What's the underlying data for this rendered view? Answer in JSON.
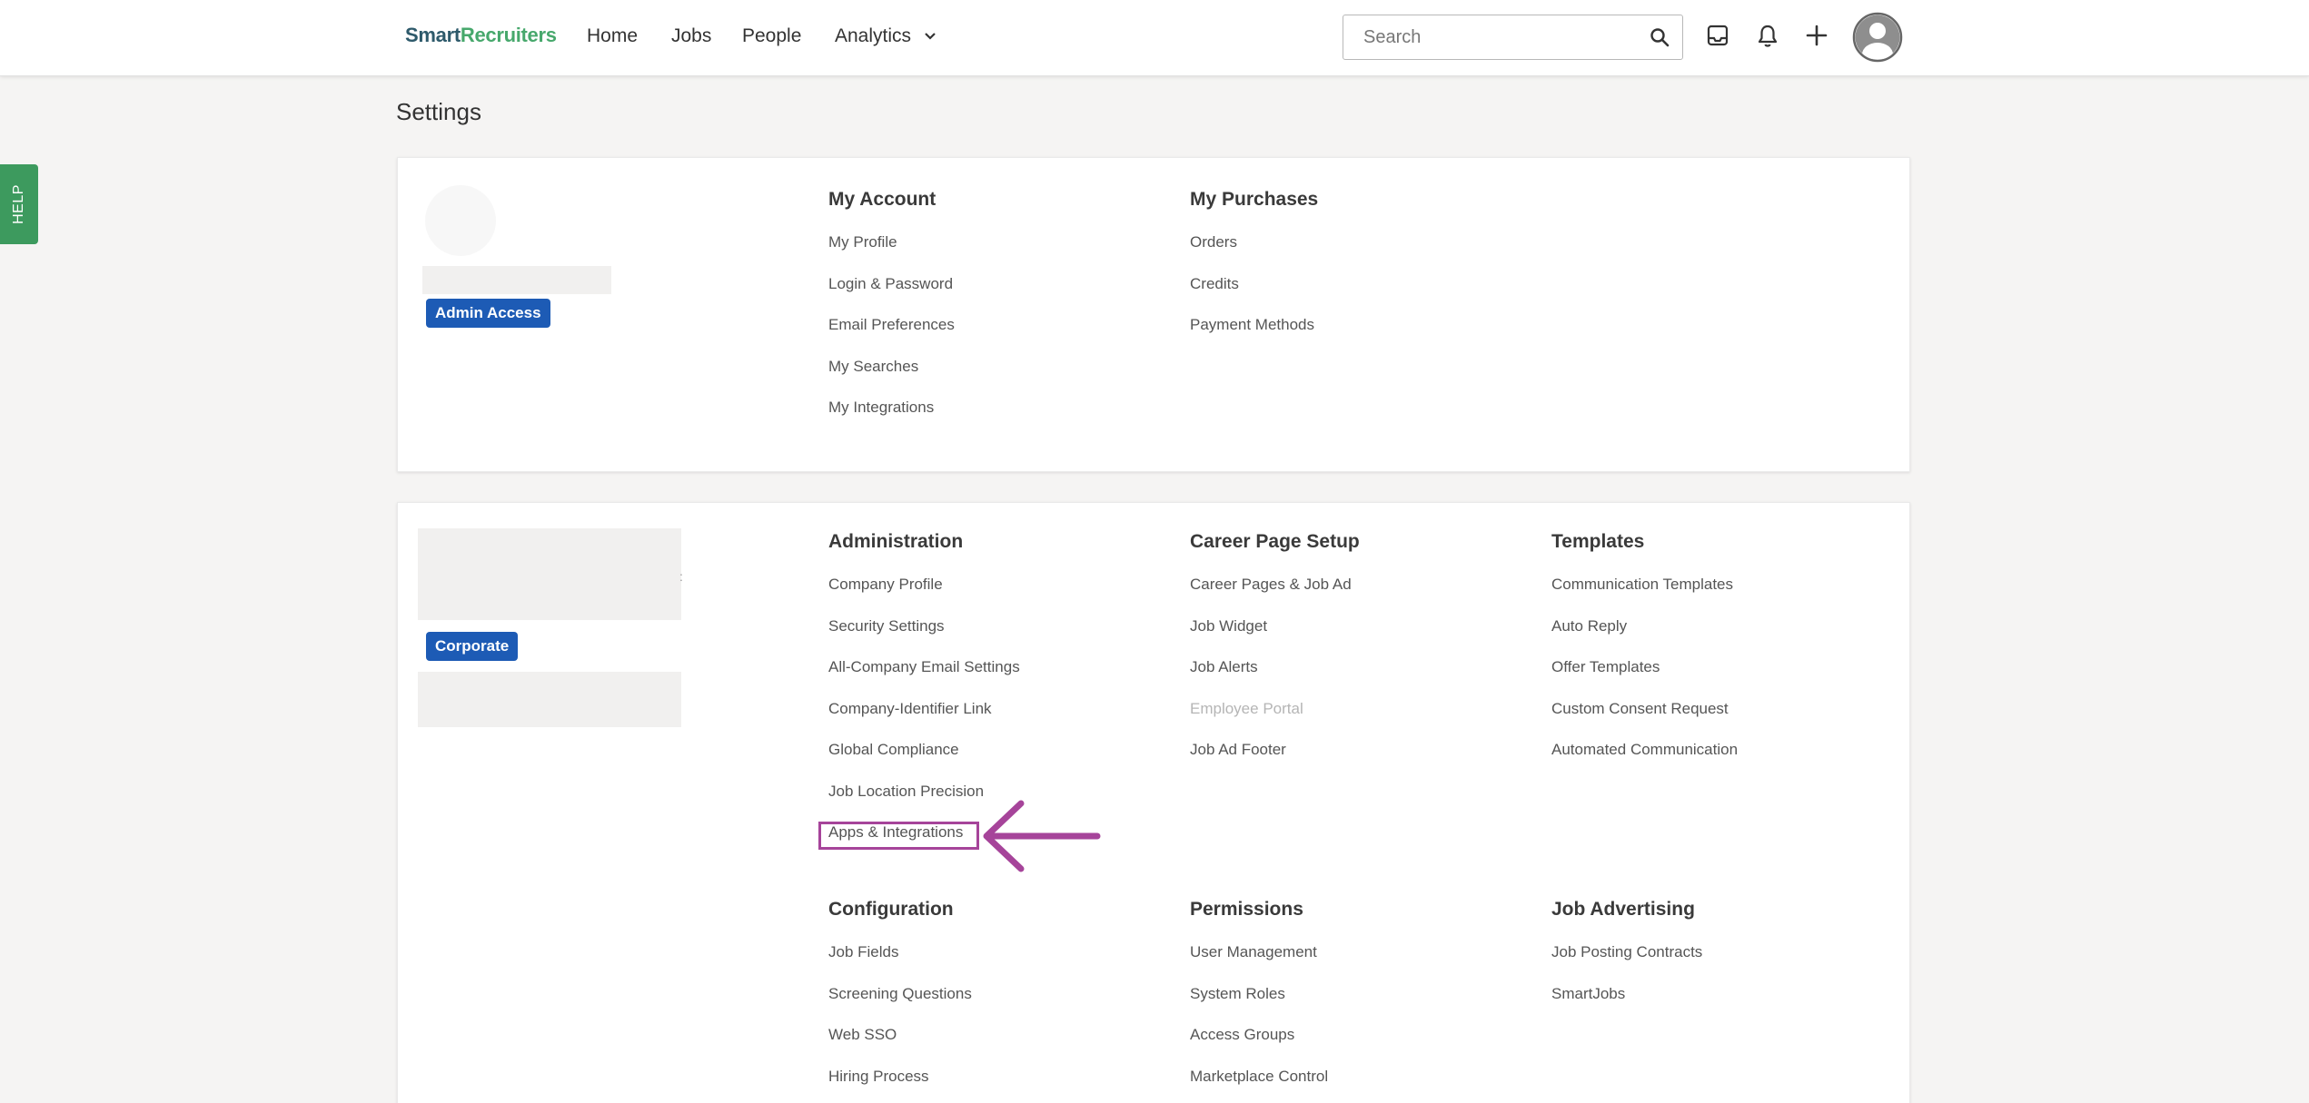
{
  "nav": {
    "logo_part1": "Smart",
    "logo_part2": "Recruiters",
    "home": "Home",
    "jobs": "Jobs",
    "people": "People",
    "analytics": "Analytics",
    "search_placeholder": "Search"
  },
  "help": {
    "label": "HELP"
  },
  "page": {
    "title": "Settings"
  },
  "account_card": {
    "badge": "Admin Access",
    "my_account": {
      "title": "My Account",
      "items": [
        "My Profile",
        "Login & Password",
        "Email Preferences",
        "My Searches",
        "My Integrations"
      ]
    },
    "my_purchases": {
      "title": "My Purchases",
      "items": [
        "Orders",
        "Credits",
        "Payment Methods"
      ]
    }
  },
  "company_card": {
    "badge": "Corporate",
    "administration": {
      "title": "Administration",
      "items": [
        "Company Profile",
        "Security Settings",
        "All-Company Email Settings",
        "Company-Identifier Link",
        "Global Compliance",
        "Job Location Precision",
        "Apps & Integrations"
      ]
    },
    "career_page_setup": {
      "title": "Career Page Setup",
      "items": [
        "Career Pages & Job Ad",
        "Job Widget",
        "Job Alerts",
        "Employee Portal",
        "Job Ad Footer"
      ]
    },
    "templates": {
      "title": "Templates",
      "items": [
        "Communication Templates",
        "Auto Reply",
        "Offer Templates",
        "Custom Consent Request",
        "Automated Communication"
      ]
    },
    "configuration": {
      "title": "Configuration",
      "items": [
        "Job Fields",
        "Screening Questions",
        "Web SSO",
        "Hiring Process"
      ]
    },
    "permissions": {
      "title": "Permissions",
      "items": [
        "User Management",
        "System Roles",
        "Access Groups",
        "Marketplace Control"
      ]
    },
    "job_advertising": {
      "title": "Job Advertising",
      "items": [
        "Job Posting Contracts",
        "SmartJobs"
      ]
    }
  },
  "annotation": {
    "highlight_color": "#a6449a"
  },
  "colors": {
    "brand_green": "#47a86c",
    "brand_dark": "#2e5a6b",
    "badge_blue": "#1d5bb5",
    "help_green": "#3d9a5e"
  }
}
